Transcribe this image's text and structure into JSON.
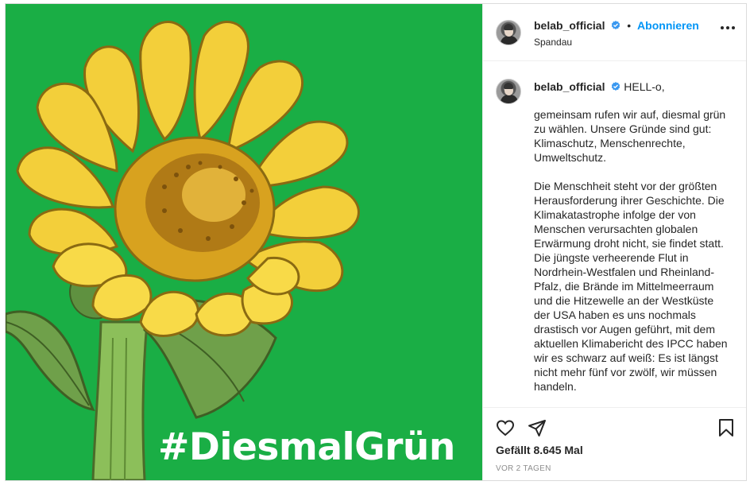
{
  "post": {
    "image_hashtag": "#DiesmalGrün",
    "colors": {
      "background_green": "#1aae45",
      "link_blue": "#0095f6",
      "verified_blue": "#3897f0"
    }
  },
  "header": {
    "username": "belab_official",
    "separator": "•",
    "follow_label": "Abonnieren",
    "location": "Spandau",
    "icons": {
      "verified": "verified-badge-icon",
      "more": "more-options-icon"
    }
  },
  "caption": {
    "username": "belab_official",
    "greeting": "HELL-o,",
    "paragraph1": "gemeinsam rufen wir auf, diesmal grün zu wählen. Unsere Gründe sind gut: Klimaschutz, Menschenrechte, Umweltschutz.",
    "paragraph2": "Die Menschheit steht vor der größten Herausforderung ihrer Geschichte. Die Klimakatastrophe infolge der von Menschen verursachten globalen Erwärmung droht nicht, sie findet statt. Die jüngste verheerende Flut in Nordrhein-Westfalen und Rheinland-Pfalz, die Brände im Mittelmeerraum und die Hitzewelle an der Westküste der USA haben es uns nochmals drastisch vor Augen geführt, mit dem aktuellen Klimabericht des IPCC haben wir es schwarz auf weiß: Es ist längst nicht mehr fünf vor zwölf, wir müssen handeln."
  },
  "actions": {
    "likes_text": "Gefällt 8.645 Mal",
    "timestamp": "VOR 2 TAGEN",
    "icons": {
      "like": "heart-icon",
      "share": "share-icon",
      "save": "bookmark-icon"
    }
  }
}
